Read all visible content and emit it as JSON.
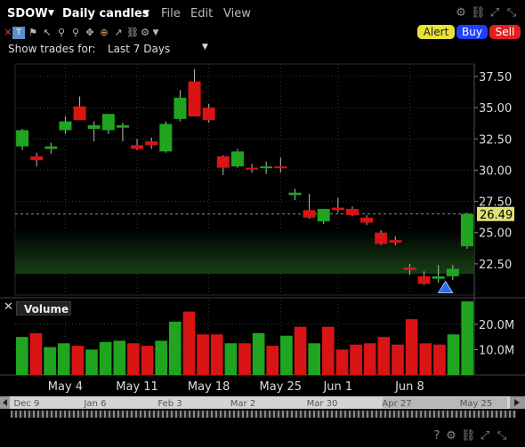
{
  "title_bar": {
    "symbol": "SDOW",
    "chart_type": "Daily candles",
    "menus": [
      "File",
      "Edit",
      "View"
    ]
  },
  "actions": {
    "alert": "Alert",
    "buy": "Buy",
    "sell": "Sell"
  },
  "show_trades": {
    "label": "Show trades for:",
    "value": "Last 7 Days"
  },
  "volume_panel": {
    "title": "Volume"
  },
  "colors": {
    "up": "#1fa51f",
    "down": "#d81414",
    "price_tag_bg": "#e0e070",
    "background": "#000000"
  },
  "chart_data": [
    {
      "type": "candlestick",
      "ylim": [
        20,
        38.5
      ],
      "y_ticks": [
        "37.50",
        "35.00",
        "32.50",
        "30.00",
        "27.50",
        "25.00",
        "22.50"
      ],
      "last_price": "26.49",
      "x_ticks": [
        "May 4",
        "May 11",
        "May 18",
        "May 25",
        "Jun 1",
        "Jun 8"
      ],
      "candles": [
        {
          "o": 31.9,
          "h": 33.3,
          "l": 31.6,
          "c": 33.2
        },
        {
          "o": 31.1,
          "h": 31.4,
          "l": 30.3,
          "c": 30.8
        },
        {
          "o": 31.7,
          "h": 32.2,
          "l": 31.3,
          "c": 31.9
        },
        {
          "o": 33.2,
          "h": 34.3,
          "l": 32.9,
          "c": 33.9
        },
        {
          "o": 35.1,
          "h": 35.9,
          "l": 34.0,
          "c": 34.0
        },
        {
          "o": 33.3,
          "h": 33.9,
          "l": 32.3,
          "c": 33.6
        },
        {
          "o": 33.2,
          "h": 34.5,
          "l": 32.9,
          "c": 34.5
        },
        {
          "o": 33.4,
          "h": 33.8,
          "l": 32.3,
          "c": 33.6
        },
        {
          "o": 32.0,
          "h": 32.5,
          "l": 31.6,
          "c": 31.7
        },
        {
          "o": 32.3,
          "h": 32.6,
          "l": 31.7,
          "c": 32.0
        },
        {
          "o": 31.5,
          "h": 33.9,
          "l": 31.4,
          "c": 33.7
        },
        {
          "o": 34.1,
          "h": 36.4,
          "l": 33.9,
          "c": 35.8
        },
        {
          "o": 37.1,
          "h": 38.1,
          "l": 34.3,
          "c": 34.3
        },
        {
          "o": 35.0,
          "h": 35.3,
          "l": 33.8,
          "c": 34.0
        },
        {
          "o": 31.1,
          "h": 31.2,
          "l": 29.6,
          "c": 30.2
        },
        {
          "o": 30.3,
          "h": 31.7,
          "l": 30.2,
          "c": 31.5
        },
        {
          "o": 30.2,
          "h": 30.5,
          "l": 29.8,
          "c": 30.1
        },
        {
          "o": 30.2,
          "h": 30.7,
          "l": 29.7,
          "c": 30.3
        },
        {
          "o": 30.3,
          "h": 31.0,
          "l": 29.8,
          "c": 30.2
        },
        {
          "o": 28.0,
          "h": 28.5,
          "l": 27.6,
          "c": 28.2
        },
        {
          "o": 26.8,
          "h": 28.1,
          "l": 26.1,
          "c": 26.2
        },
        {
          "o": 25.9,
          "h": 26.9,
          "l": 25.7,
          "c": 26.9
        },
        {
          "o": 27.0,
          "h": 27.8,
          "l": 26.6,
          "c": 26.8
        },
        {
          "o": 26.9,
          "h": 27.1,
          "l": 26.3,
          "c": 26.4
        },
        {
          "o": 26.2,
          "h": 26.4,
          "l": 25.6,
          "c": 25.8
        },
        {
          "o": 25.0,
          "h": 25.2,
          "l": 24.0,
          "c": 24.1
        },
        {
          "o": 24.4,
          "h": 24.7,
          "l": 24.0,
          "c": 24.2
        },
        {
          "o": 22.2,
          "h": 22.5,
          "l": 21.6,
          "c": 22.0
        },
        {
          "o": 21.5,
          "h": 21.9,
          "l": 20.8,
          "c": 20.9
        },
        {
          "o": 21.3,
          "h": 22.4,
          "l": 21.0,
          "c": 21.5
        },
        {
          "o": 21.5,
          "h": 22.4,
          "l": 21.2,
          "c": 22.1
        },
        {
          "o": 23.9,
          "h": 26.6,
          "l": 23.7,
          "c": 26.5
        }
      ],
      "trade_marker": {
        "index": 29,
        "price": 21.1
      }
    },
    {
      "type": "bar",
      "title": "Volume",
      "ylim": [
        0,
        28
      ],
      "y_ticks": [
        "20.0M",
        "10.0M"
      ],
      "values": [
        15,
        16.5,
        11,
        12.5,
        11.5,
        10,
        13,
        13.5,
        12.5,
        11.5,
        13.5,
        21,
        25,
        16,
        16,
        12.5,
        12.5,
        16.5,
        11.5,
        15.5,
        19,
        12.5,
        19,
        10,
        12,
        12.5,
        15,
        12,
        22,
        12.5,
        12,
        16,
        29
      ],
      "directions": [
        "up",
        "down",
        "up",
        "up",
        "down",
        "up",
        "up",
        "up",
        "down",
        "down",
        "up",
        "up",
        "down",
        "down",
        "down",
        "up",
        "down",
        "up",
        "down",
        "up",
        "down",
        "up",
        "down",
        "down",
        "down",
        "down",
        "down",
        "down",
        "down",
        "down",
        "down",
        "up",
        "up"
      ]
    }
  ],
  "navigator": {
    "labels": [
      "Dec 9",
      "Jan 6",
      "Feb 3",
      "Mar 2",
      "Mar 30",
      "Apr 27",
      "May 25"
    ]
  }
}
